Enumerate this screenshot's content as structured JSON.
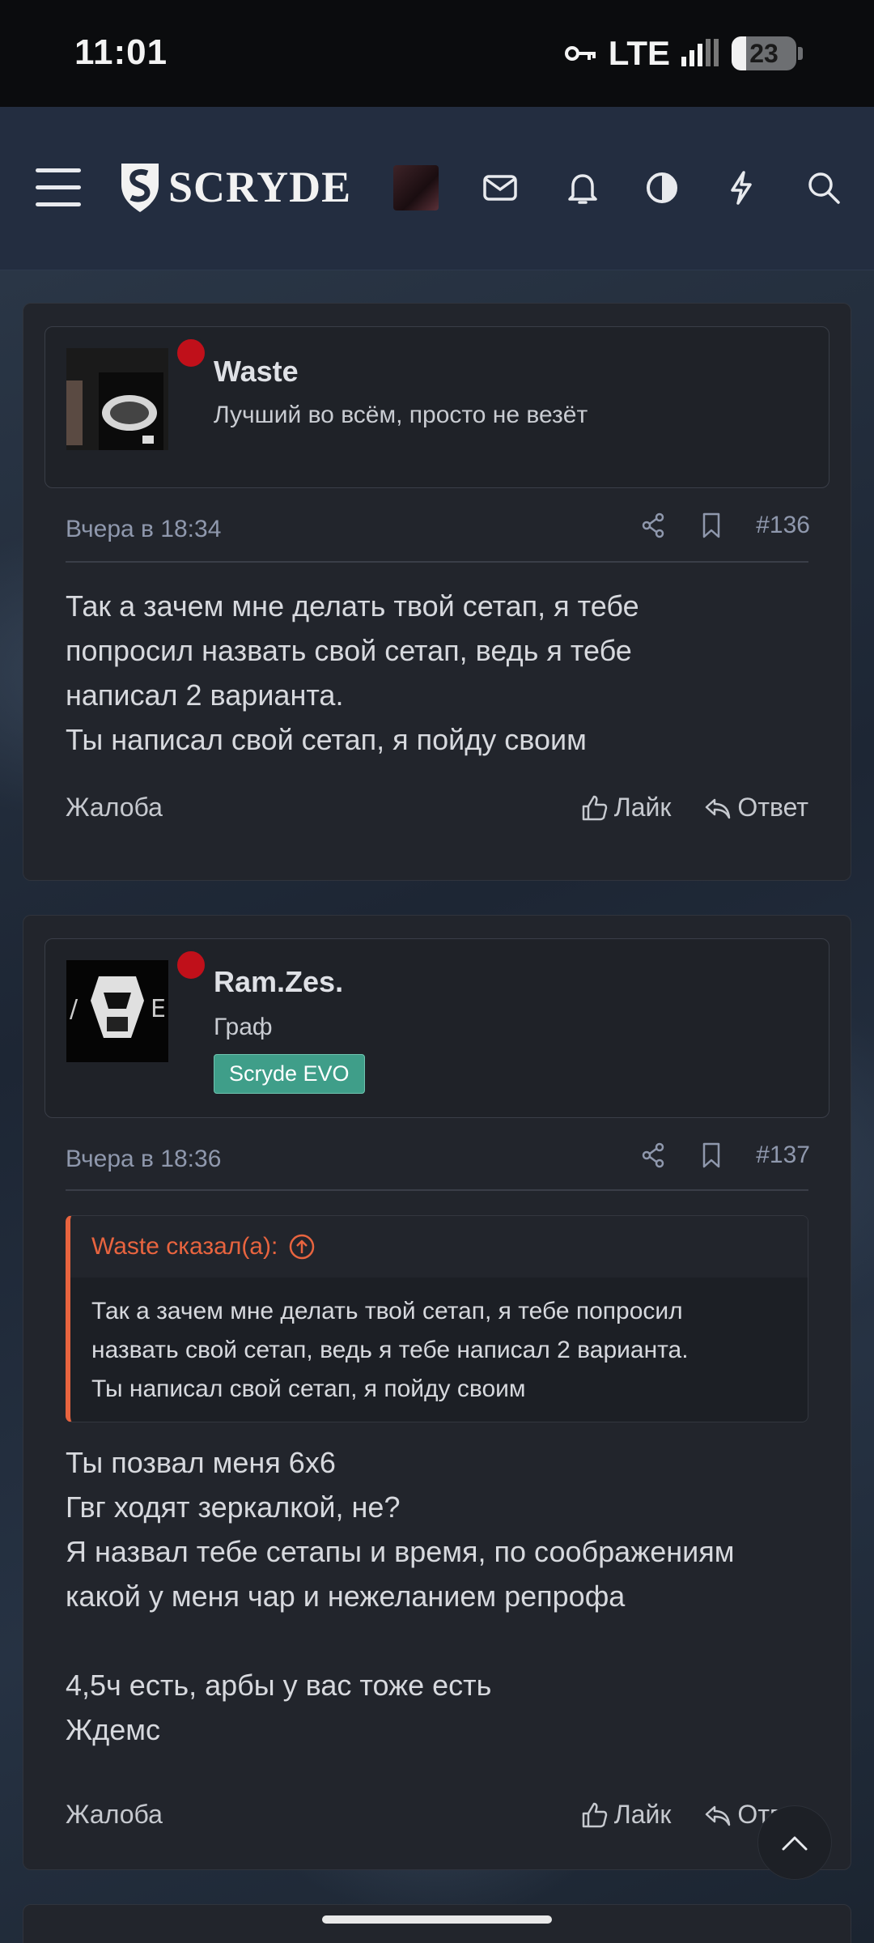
{
  "status_bar": {
    "time": "11:01",
    "network": "LTE",
    "battery": "23",
    "battery_level": 0.23
  },
  "header": {
    "logo_text": "SCRYDE"
  },
  "posts": [
    {
      "username": "Waste",
      "user_title": "Лучший во всём, просто не везёт",
      "date": "Вчера в 18:34",
      "number": "#136",
      "message": [
        "Так а зачем мне делать твой сетап, я тебе",
        "попросил назвать свой сетап, ведь я тебе",
        "написал 2 варианта.",
        "Ты написал свой сетап, я пойду своим"
      ],
      "report": "Жалоба",
      "like": "Лайк",
      "reply": "Ответ"
    },
    {
      "username": "Ram.Zes.",
      "user_title": "Граф",
      "badge": "Scryde EVO",
      "date": "Вчера в 18:36",
      "number": "#137",
      "quote_author": "Waste сказал(а):",
      "quote_lines": [
        "Так а зачем мне делать твой сетап, я тебе попросил",
        "назвать свой сетап, ведь я тебе написал 2 варианта.",
        "Ты написал свой сетап, я пойду своим"
      ],
      "message": [
        "Ты позвал меня 6х6",
        "Гвг ходят зеркалкой, не?",
        "Я назвал тебе сетапы и время, по соображениям",
        "какой у меня чар и нежеланием репрофа",
        "",
        "4,5ч есть, арбы у вас тоже есть",
        "Ждемс"
      ],
      "report": "Жалоба",
      "like": "Лайк",
      "reply": "Ответ"
    }
  ]
}
